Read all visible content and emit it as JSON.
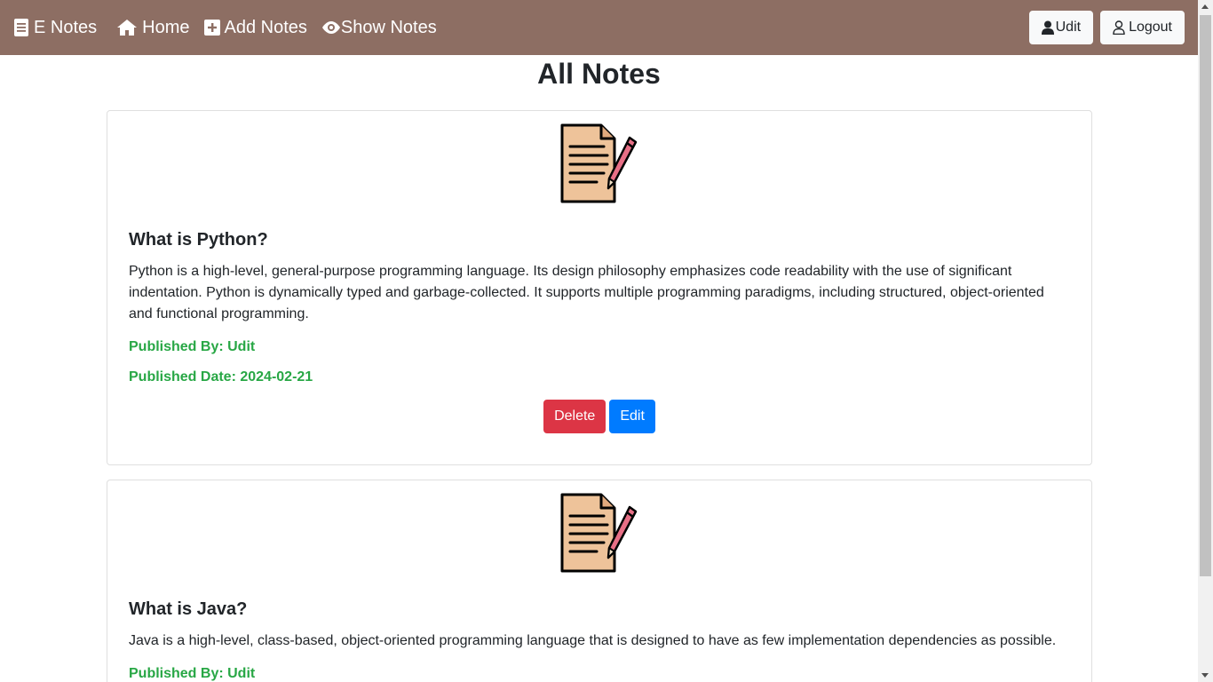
{
  "navbar": {
    "brand": "E Notes",
    "links": [
      {
        "label": "Home",
        "icon": "home-icon"
      },
      {
        "label": "Add Notes",
        "icon": "plus-square-icon"
      },
      {
        "label": "Show Notes",
        "icon": "eye-icon"
      }
    ],
    "user_label": "Udit",
    "logout_label": "Logout",
    "bg_color": "#8d6e63"
  },
  "page_title": "All Notes",
  "notes": [
    {
      "title": "What is Python?",
      "content": "Python is a high-level, general-purpose programming language. Its design philosophy emphasizes code readability with the use of significant indentation. Python is dynamically typed and garbage-collected. It supports multiple programming paradigms, including structured, object-oriented and functional programming.",
      "published_by": "Published By: Udit",
      "published_date": "Published Date: 2024-02-21",
      "delete_label": "Delete",
      "edit_label": "Edit"
    },
    {
      "title": "What is Java?",
      "content": "Java is a high-level, class-based, object-oriented programming language that is designed to have as few implementation dependencies as possible.",
      "published_by": "Published By: Udit"
    }
  ]
}
